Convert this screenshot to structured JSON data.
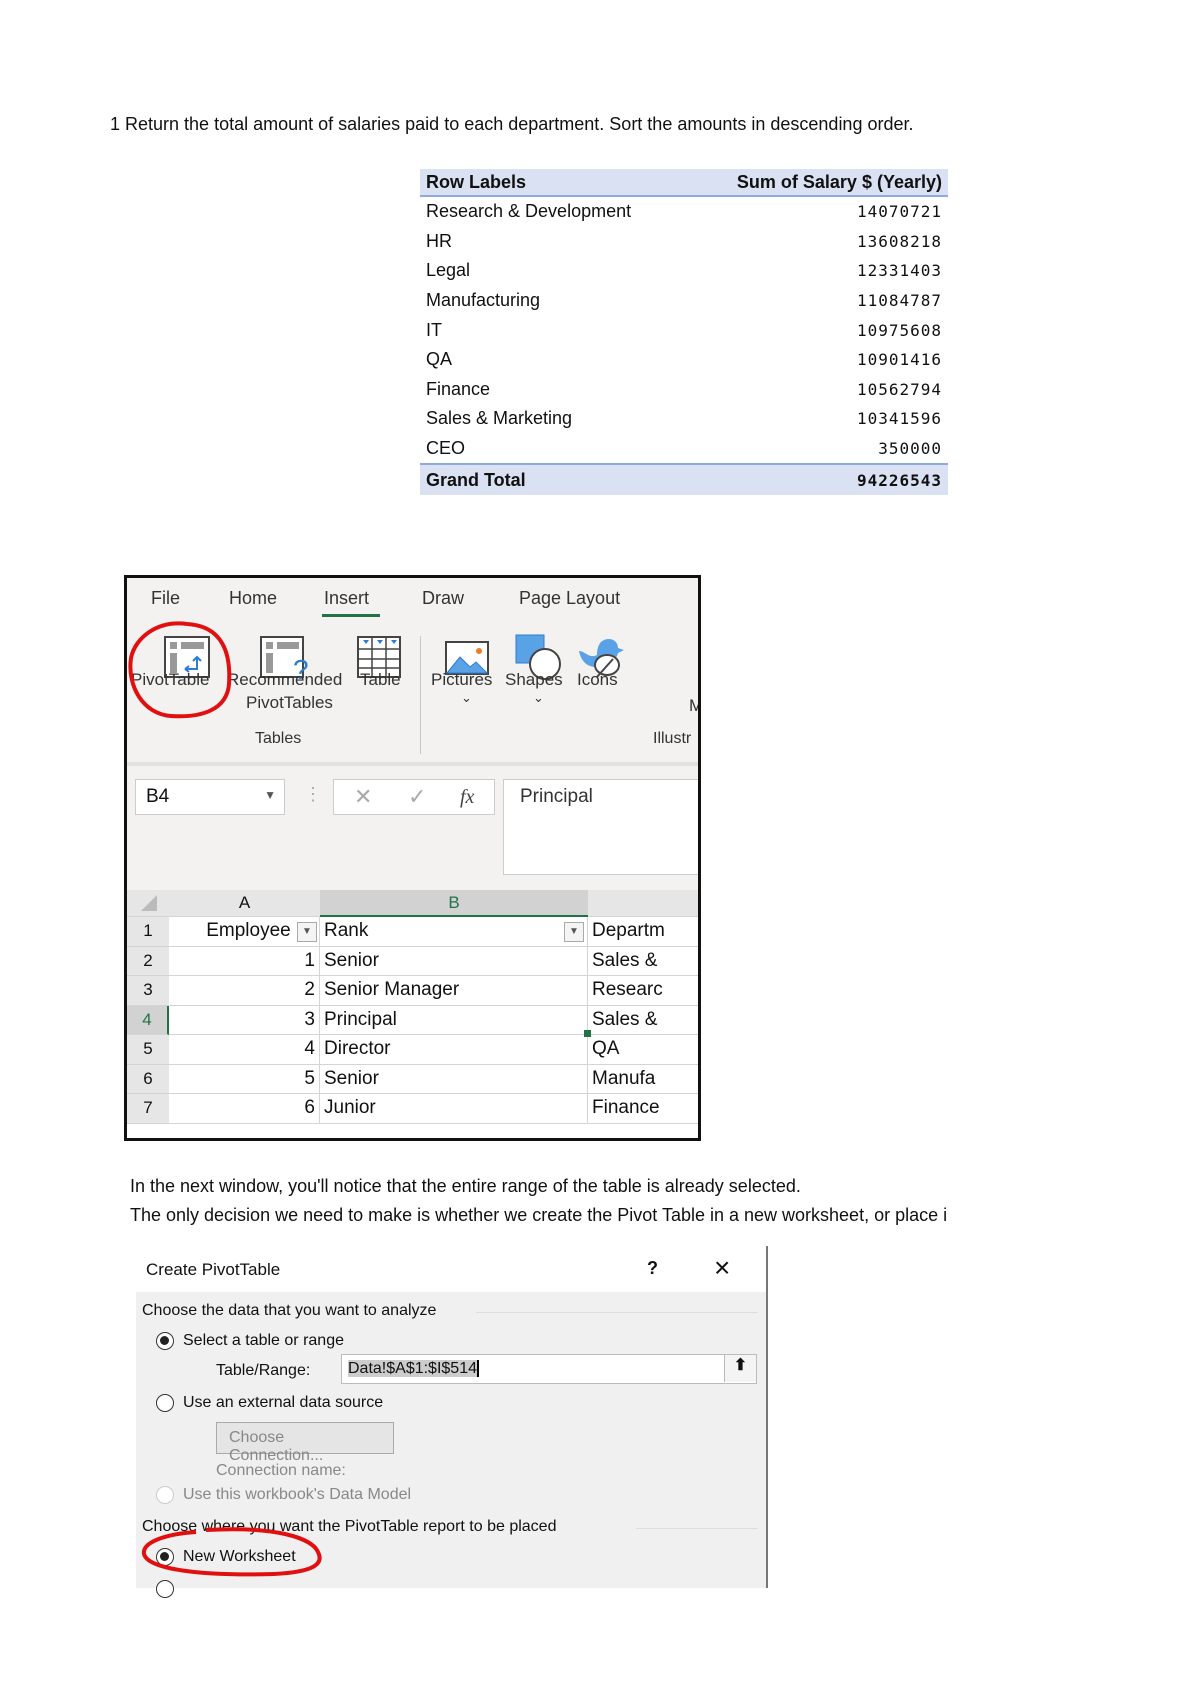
{
  "question": "1 Return the total amount of salaries paid to each department. Sort the amounts in descending order.",
  "pivot": {
    "headers": [
      "Row Labels",
      "Sum of Salary $ (Yearly)"
    ],
    "rows": [
      [
        "Research & Development",
        "14070721"
      ],
      [
        "HR",
        "13608218"
      ],
      [
        "Legal",
        "12331403"
      ],
      [
        "Manufacturing",
        "11084787"
      ],
      [
        "IT",
        "10975608"
      ],
      [
        "QA",
        "10901416"
      ],
      [
        "Finance",
        "10562794"
      ],
      [
        "Sales & Marketing",
        "10341596"
      ],
      [
        "CEO",
        "350000"
      ]
    ],
    "total": [
      "Grand Total",
      "94226543"
    ]
  },
  "excel": {
    "tabs": [
      "File",
      "Home",
      "Insert",
      "Draw",
      "Page Layout"
    ],
    "active_tab": "Insert",
    "ribbon": {
      "pivottable": "PivotTable",
      "recommended": "Recommended",
      "recommended2": "PivotTables",
      "table": "Table",
      "pictures": "Pictures",
      "shapes": "Shapes",
      "icons": "Icons",
      "more": "M",
      "group_tables": "Tables",
      "group_illus": "Illustr"
    },
    "name_box": "B4",
    "formula": "Principal",
    "fx": "fx",
    "columns": [
      "A",
      "B"
    ],
    "header_row": {
      "num": "1",
      "a": "Employee ID",
      "b": "Rank",
      "c": "Departm"
    },
    "rows": [
      [
        "2",
        "1",
        "Senior",
        "Sales &"
      ],
      [
        "3",
        "2",
        "Senior Manager",
        "Researc"
      ],
      [
        "4",
        "3",
        "Principal",
        "Sales &"
      ],
      [
        "5",
        "4",
        "Director",
        "QA"
      ],
      [
        "6",
        "5",
        "Senior",
        "Manufa"
      ],
      [
        "7",
        "6",
        "Junior",
        "Finance"
      ]
    ],
    "accent": "#217346"
  },
  "para": [
    "In the next window, you'll notice that the entire range of the table is already selected.",
    "The only decision we need to make is whether we create the Pivot Table in a new worksheet, or place i"
  ],
  "dialog": {
    "title": "Create PivotTable",
    "help": "?",
    "close": "×",
    "section1": "Choose the data that you want to analyze",
    "opt_select": "Select a table or range",
    "range_label": "Table/Range:",
    "range_value": "Data!$A$1:$I$514",
    "opt_external": "Use an external data source",
    "choose_conn": "Choose Connection...",
    "conn_name": "Connection name:",
    "opt_model": "Use this workbook's Data Model",
    "section2": "Choose where you want the PivotTable report to be placed",
    "opt_new": "New Worksheet"
  }
}
